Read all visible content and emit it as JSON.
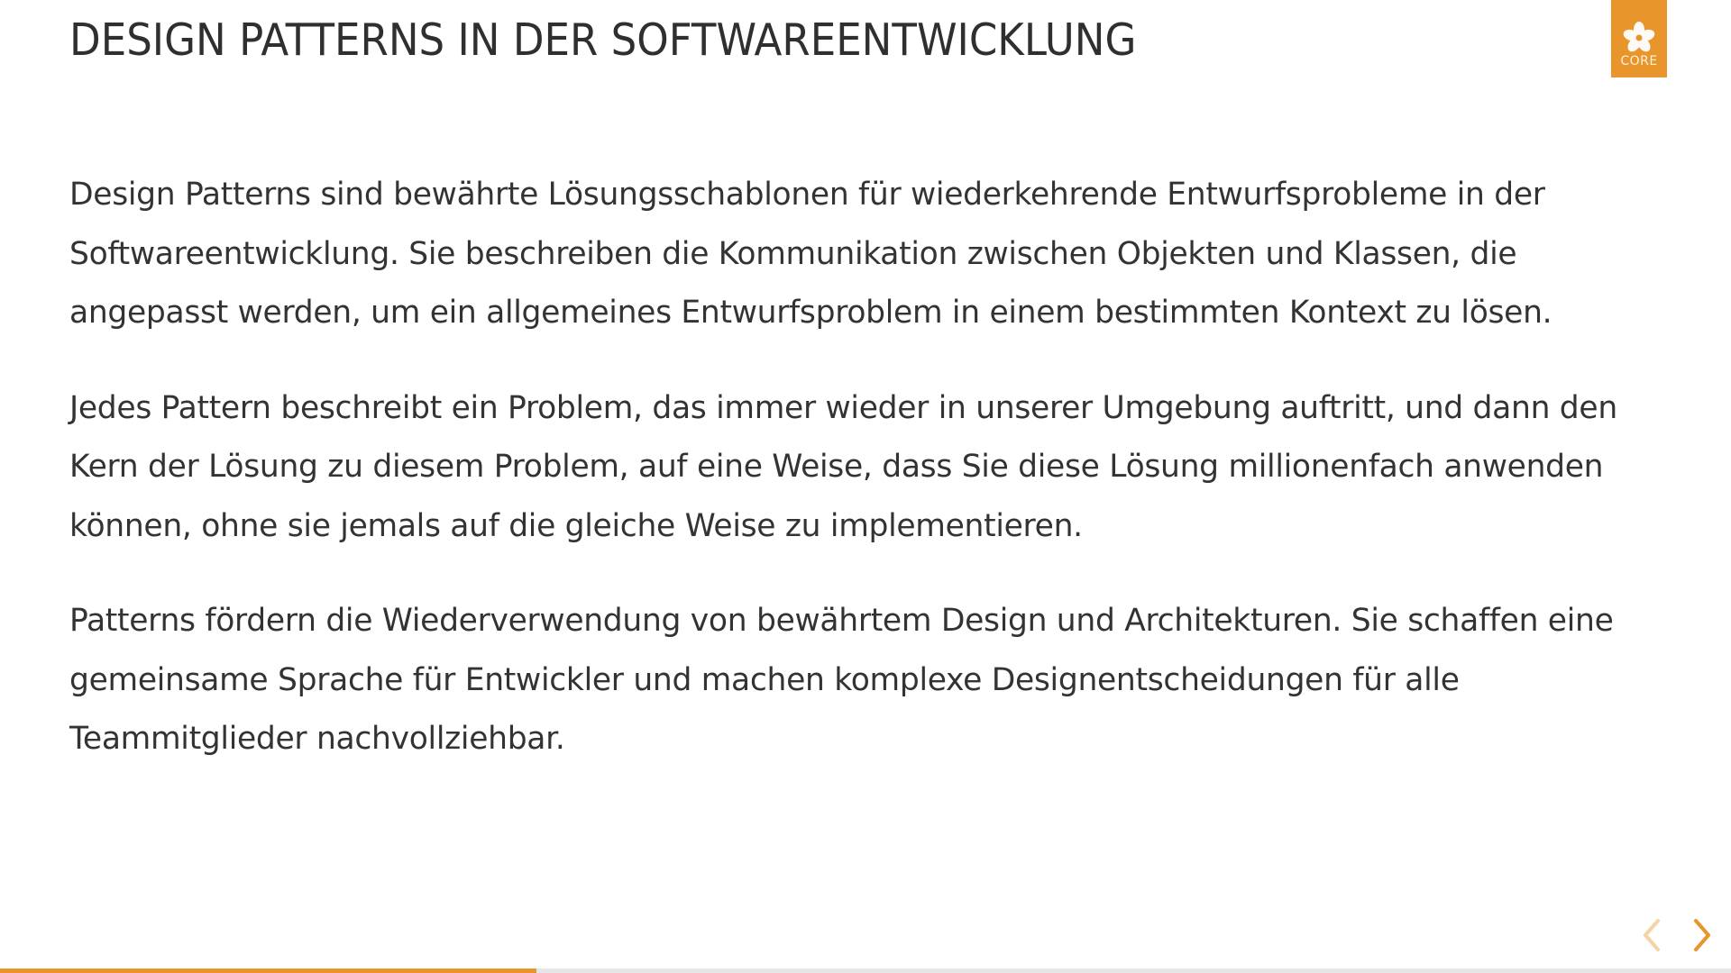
{
  "slide": {
    "title": "DESIGN PATTERNS IN DER SOFTWAREENTWICKLUNG",
    "paragraphs": [
      "Design Patterns sind bewährte Lösungsschablonen für wiederkehrende Entwurfsprobleme in der Softwareentwicklung. Sie beschreiben die Kommunikation zwischen Objekten und Klassen, die angepasst werden, um ein allgemeines Entwurfsproblem in einem bestimmten Kontext zu lösen.",
      "Jedes Pattern beschreibt ein Problem, das immer wieder in unserer Umgebung auftritt, und dann den Kern der Lösung zu diesem Problem, auf eine Weise, dass Sie diese Lösung millionenfach anwenden können, ohne sie jemals auf die gleiche Weise zu implementieren.",
      "Patterns fördern die Wiederverwendung von bewährtem Design und Architekturen. Sie schaffen eine gemeinsame Sprache für Entwickler und machen komplexe Designentscheidungen für alle Teammitglieder nachvollziehbar."
    ]
  },
  "logo": {
    "text": "CORE",
    "icon": "flower-icon",
    "color": "#e8952b"
  },
  "navigation": {
    "prev_icon": "chevron-left-icon",
    "next_icon": "chevron-right-icon",
    "prev_enabled": false,
    "next_enabled": true,
    "accent_color": "#e8952b"
  },
  "progress": {
    "fraction": 0.31
  }
}
